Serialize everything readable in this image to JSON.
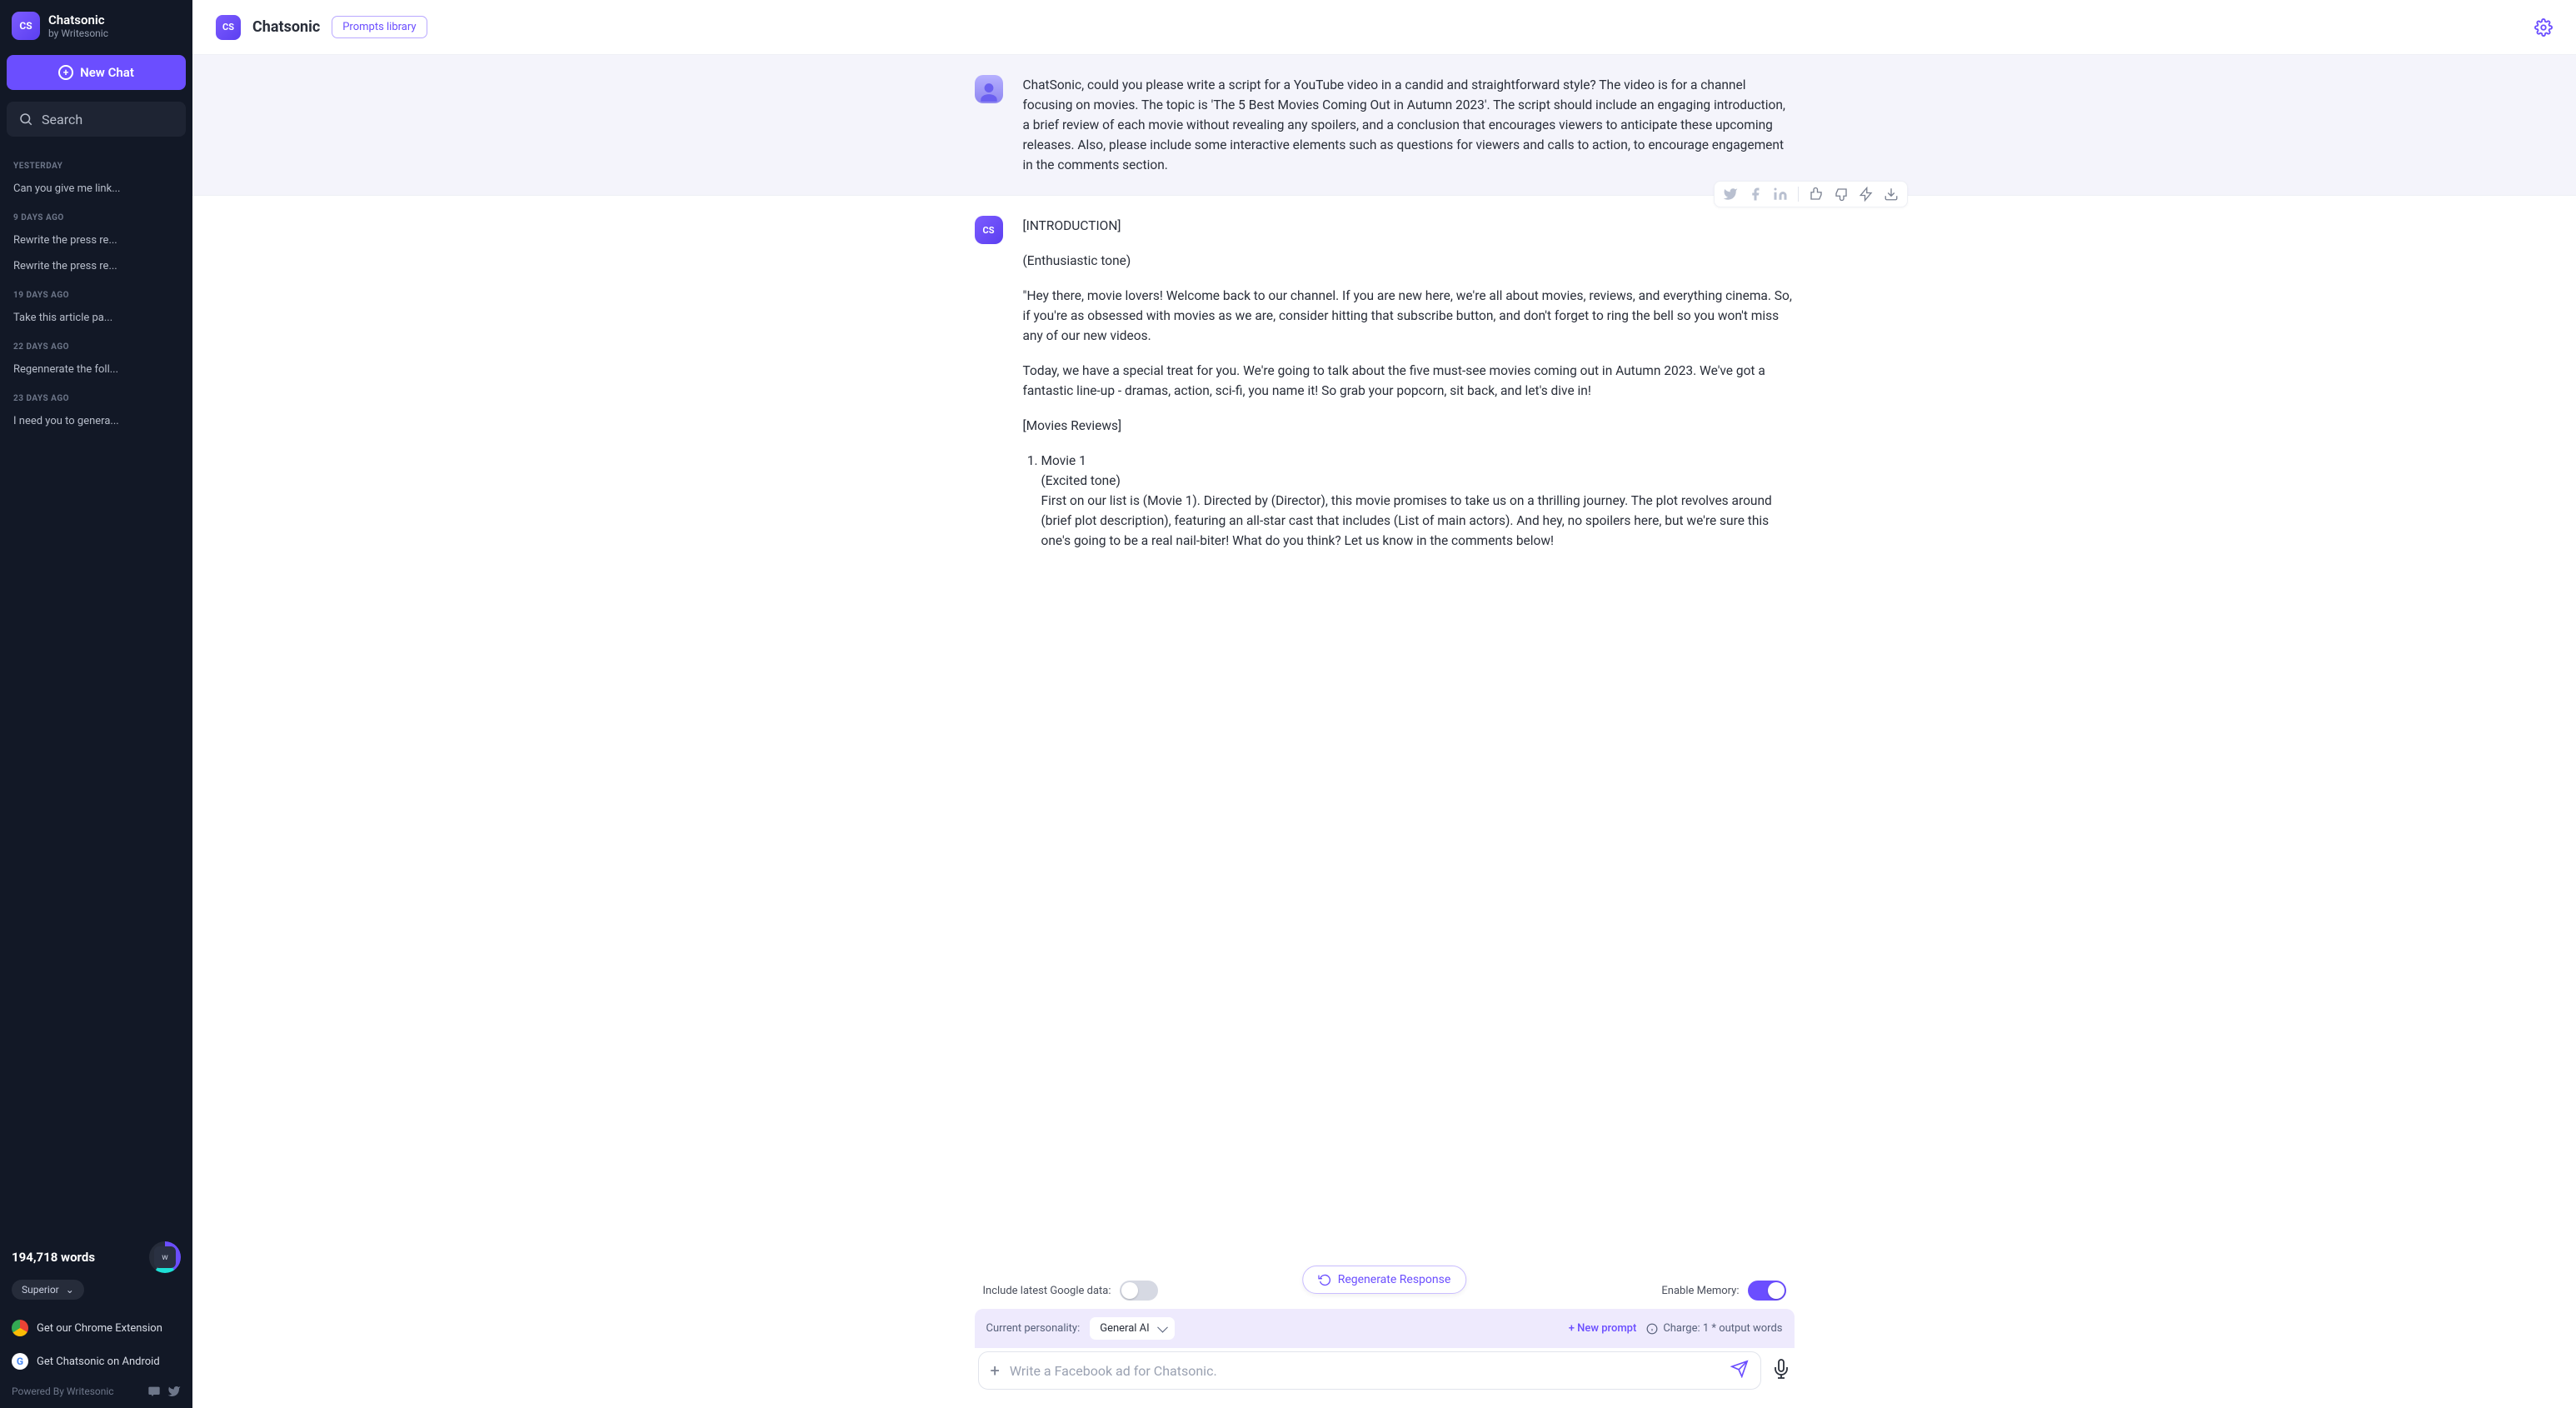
{
  "brand": {
    "name": "Chatsonic",
    "sub": "by Writesonic",
    "logo_text": "CS"
  },
  "sidebar": {
    "new_chat": "New Chat",
    "search": "Search",
    "sections": [
      {
        "label": "YESTERDAY",
        "items": [
          "Can you give me link..."
        ]
      },
      {
        "label": "9 DAYS AGO",
        "items": [
          "Rewrite the press re...",
          "Rewrite the press re..."
        ]
      },
      {
        "label": "19 DAYS AGO",
        "items": [
          "Take this article pa..."
        ]
      },
      {
        "label": "22 DAYS AGO",
        "items": [
          "Regennerate the foll..."
        ]
      },
      {
        "label": "23 DAYS AGO",
        "items": [
          "I need you to genera..."
        ]
      }
    ],
    "words": "194,718 words",
    "plan": "Superior",
    "links": {
      "chrome": "Get our Chrome Extension",
      "android": "Get Chatsonic on Android"
    },
    "powered": "Powered By Writesonic"
  },
  "topbar": {
    "title": "Chatsonic",
    "prompts": "Prompts library"
  },
  "conversation": {
    "user_prompt": "ChatSonic, could you please write a script for a YouTube video in a candid and straightforward style? The video is for a channel focusing on movies. The topic is 'The 5 Best Movies Coming Out in Autumn 2023'. The script should include an engaging introduction, a brief review of each movie without revealing any spoilers, and a conclusion that encourages viewers to anticipate these upcoming releases. Also, please include some interactive elements such as questions for viewers and calls to action, to encourage engagement in the comments section.",
    "answer": {
      "p1": "[INTRODUCTION]",
      "p2": "(Enthusiastic tone)",
      "p3": "\"Hey there, movie lovers! Welcome back to our channel. If you are new here, we're all about movies, reviews, and everything cinema. So, if you're as obsessed with movies as we are, consider hitting that subscribe button, and don't forget to ring the bell so you won't miss any of our new videos.",
      "p4": "Today, we have a special treat for you. We're going to talk about the five must-see movies coming out in Autumn 2023. We've got a fantastic line-up - dramas, action, sci-fi, you name it! So grab your popcorn, sit back, and let's dive in!",
      "p5": "[Movies Reviews]",
      "li_title": "Movie 1",
      "li_tone": "(Excited tone)",
      "li_body": "First on our list is (Movie 1). Directed by (Director), this movie promises to take us on a thrilling journey. The plot revolves around (brief plot description), featuring an all-star cast that includes (List of main actors). And hey, no spoilers here, but we're sure this one's going to be a real nail-biter! What do you think? Let us know in the comments below!"
    }
  },
  "composer": {
    "google_toggle": "Include latest Google data:",
    "memory_toggle": "Enable Memory:",
    "regenerate": "Regenerate Response",
    "personality_label": "Current personality:",
    "personality_value": "General AI",
    "new_prompt": "+ New prompt",
    "charge": "Charge: 1 * output words",
    "placeholder": "Write a Facebook ad for Chatsonic."
  }
}
